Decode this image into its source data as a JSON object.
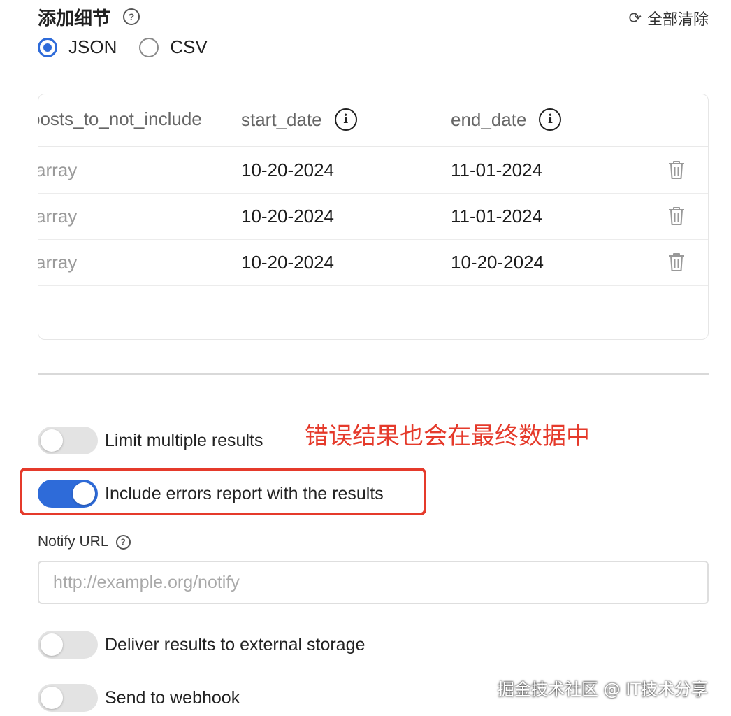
{
  "header": {
    "title": "添加细节",
    "help_icon": "question-circle-icon",
    "clear_all_label": "全部清除",
    "clear_icon": "refresh-icon"
  },
  "format": {
    "options": [
      {
        "label": "JSON",
        "checked": true
      },
      {
        "label": "CSV",
        "checked": false
      }
    ]
  },
  "table": {
    "columns": [
      {
        "label": "posts_to_not_include"
      },
      {
        "label": "start_date",
        "icon": "info-icon"
      },
      {
        "label": "end_date",
        "icon": "info-icon"
      }
    ],
    "rows": [
      {
        "posts_to_not_include": "array",
        "start_date": "10-20-2024",
        "end_date": "11-01-2024"
      },
      {
        "posts_to_not_include": "array",
        "start_date": "10-20-2024",
        "end_date": "11-01-2024"
      },
      {
        "posts_to_not_include": "array",
        "start_date": "10-20-2024",
        "end_date": "10-20-2024"
      }
    ],
    "row_action_icon": "trash-icon"
  },
  "options": {
    "limit_multiple_results": {
      "label": "Limit multiple results",
      "on": false
    },
    "include_errors": {
      "label": "Include errors report with the results",
      "on": true
    },
    "deliver_external": {
      "label": "Deliver results to external storage",
      "on": false
    },
    "send_webhook": {
      "label": "Send to webhook",
      "on": false
    }
  },
  "notify_url": {
    "label": "Notify URL",
    "placeholder": "http://example.org/notify",
    "value": ""
  },
  "annotation": {
    "text": "错误结果也会在最终数据中",
    "color": "#e53a2b"
  },
  "watermark": "掘金技术社区 @ IT技术分享",
  "colors": {
    "accent": "#2e6bd9",
    "annotation_red": "#e53a2b"
  }
}
